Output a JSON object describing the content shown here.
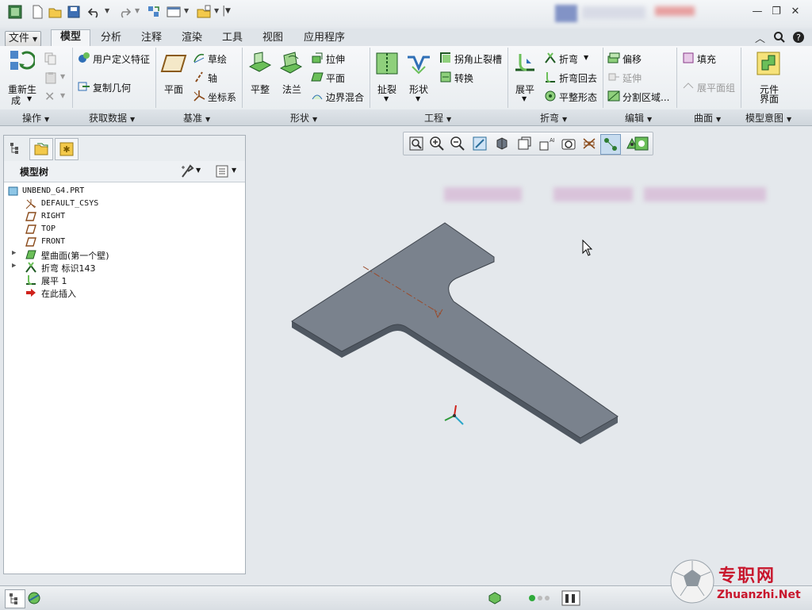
{
  "quick_access": {
    "icons": [
      "app-icon",
      "new-icon",
      "open-icon",
      "save-icon",
      "undo-icon",
      "redo-icon",
      "regenerate-icon",
      "windows-icon",
      "close-window-icon",
      "customize-icon"
    ]
  },
  "ribbon_tabs": [
    "文件",
    "模型",
    "分析",
    "注释",
    "渲染",
    "工具",
    "视图",
    "应用程序"
  ],
  "ribbon": {
    "operations": {
      "regenerate_l1": "重新生",
      "regenerate_l2": "成"
    },
    "get_data": {
      "udf": "用户定义特征",
      "copy_geom": "复制几何"
    },
    "datum": {
      "plane": "平面",
      "sketch": "草绘",
      "axis": "轴",
      "csys": "坐标系"
    },
    "shapes": {
      "flat": "平整",
      "flange": "法兰",
      "extrude": "拉伸",
      "planar": "平面",
      "blend": "边界混合"
    },
    "engineering": {
      "rip": "扯裂",
      "form": "形状",
      "corner_relief": "拐角止裂槽",
      "convert": "转换"
    },
    "bends": {
      "unbend": "展平",
      "bend": "折弯",
      "bend_back": "折弯回去",
      "flatten_form": "平整形态"
    },
    "editing": {
      "offset": "偏移",
      "extend": "延伸",
      "split_area": "分割区域..."
    },
    "surfaces": {
      "fill": "填充",
      "flat_pattern": "展平面组"
    },
    "model_intent": {
      "component_l1": "元件",
      "component_l2": "界面"
    }
  },
  "groups": [
    "操作",
    "获取数据",
    "基准",
    "形状",
    "工程",
    "折弯",
    "编辑",
    "曲面",
    "模型意图"
  ],
  "model_tree": {
    "title": "模型树",
    "items": [
      {
        "label": "UNBEND_G4.PRT",
        "icon": "part-icon"
      },
      {
        "label": "DEFAULT_CSYS",
        "icon": "csys-icon"
      },
      {
        "label": "RIGHT",
        "icon": "datum-plane-icon"
      },
      {
        "label": "TOP",
        "icon": "datum-plane-icon"
      },
      {
        "label": "FRONT",
        "icon": "datum-plane-icon"
      },
      {
        "label": "壁曲面(第一个壁)",
        "icon": "wall-icon"
      },
      {
        "label": "折弯 标识143",
        "icon": "bend-icon"
      },
      {
        "label": "展平 1",
        "icon": "unbend-icon"
      },
      {
        "label": "在此插入",
        "icon": "insert-arrow-icon"
      }
    ]
  },
  "watermark": {
    "line1": "专职网",
    "line2": "Zhuanzhi.Net"
  }
}
